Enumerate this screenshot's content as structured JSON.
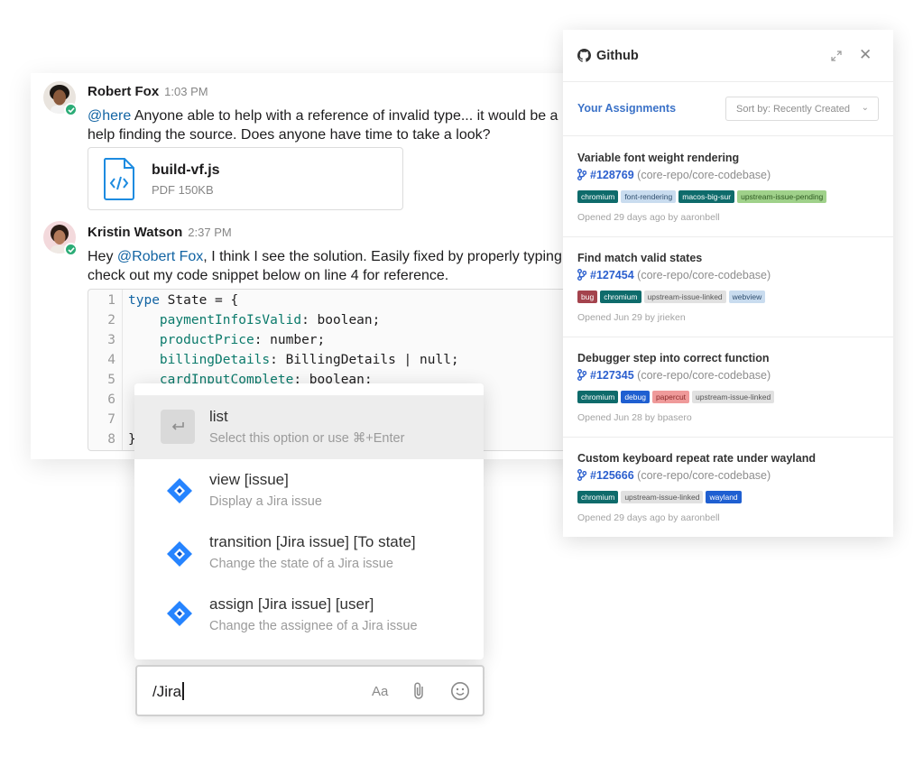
{
  "chat": {
    "messages": [
      {
        "author": "Robert Fox",
        "time": "1:03 PM",
        "mention": "@here",
        "text_1": " Anyone able to help with a reference of invalid type... it would be a",
        "text_2": "help finding the source. Does anyone have time to take a look?",
        "file": {
          "name": "build-vf.js",
          "meta": "PDF 150KB",
          "icon": "code-file-icon"
        }
      },
      {
        "author": "Kristin Watson",
        "time": "2:37 PM",
        "prefix": "Hey ",
        "mention": "@Robert Fox",
        "text_1": ", I think I see the solution. Easily fixed by properly typing",
        "text_2": "check out my code snippet below on line 4 for reference."
      }
    ],
    "code": {
      "lines": [
        {
          "n": "1",
          "kw": "type",
          "rest": " State = {"
        },
        {
          "n": "2",
          "prop": "    paymentInfoIsValid",
          "rest": ": boolean;"
        },
        {
          "n": "3",
          "prop": "    productPrice",
          "rest": ": number;"
        },
        {
          "n": "4",
          "prop": "    billingDetails",
          "rest": ": BillingDetails | null;"
        },
        {
          "n": "5",
          "prop": "    cardInputComplete",
          "rest": ": boolean;"
        },
        {
          "n": "6",
          "rest": ""
        },
        {
          "n": "7",
          "rest": ""
        },
        {
          "n": "8",
          "rest": "}"
        }
      ]
    }
  },
  "popup": {
    "options": [
      {
        "title": "list",
        "sub": "Select this option or use ⌘+Enter",
        "icon": "enter-icon",
        "selected": true
      },
      {
        "title": "view [issue]",
        "sub": "Display a Jira issue",
        "icon": "jira-icon"
      },
      {
        "title": "transition [Jira issue] [To state]",
        "sub": "Change the state of a Jira issue",
        "icon": "jira-icon"
      },
      {
        "title": "assign [Jira issue] [user]",
        "sub": "Change the assignee of a Jira issue",
        "icon": "jira-icon"
      }
    ]
  },
  "composer": {
    "value": "/Jira",
    "format_label": "Aa",
    "attach_icon": "paperclip-icon",
    "emoji_icon": "smiley-icon"
  },
  "github": {
    "title": "Github",
    "section": "Your Assignments",
    "sort": "Sort by: Recently Created",
    "issues": [
      {
        "title": "Variable font weight rendering",
        "number": "#128769",
        "repo": "(core-repo/core-codebase)",
        "labels": [
          {
            "text": "chromium",
            "bg": "#0e6b6b",
            "fg": "#ffffff"
          },
          {
            "text": "font-rendering",
            "bg": "#c9dcef",
            "fg": "#2f4e6e"
          },
          {
            "text": "macos-big-sur",
            "bg": "#0e6b6b",
            "fg": "#ffffff"
          },
          {
            "text": "upstream-issue-pending",
            "bg": "#9fd18a",
            "fg": "#2f5a22"
          }
        ],
        "opened": "Opened 29 days ago by aaronbell"
      },
      {
        "title": "Find match valid states",
        "number": "#127454",
        "repo": "(core-repo/core-codebase)",
        "labels": [
          {
            "text": "bug",
            "bg": "#a4434d",
            "fg": "#ffffff"
          },
          {
            "text": "chromium",
            "bg": "#0e6b6b",
            "fg": "#ffffff"
          },
          {
            "text": "upstream-issue-linked",
            "bg": "#e1e1e1",
            "fg": "#555555"
          },
          {
            "text": "webview",
            "bg": "#c9dcef",
            "fg": "#2f4e6e"
          }
        ],
        "opened": "Opened Jun 29 by jrieken"
      },
      {
        "title": "Debugger step into correct function",
        "number": "#127345",
        "repo": "(core-repo/core-codebase)",
        "labels": [
          {
            "text": "chromium",
            "bg": "#0e6b6b",
            "fg": "#ffffff"
          },
          {
            "text": "debug",
            "bg": "#1f5fd1",
            "fg": "#ffffff"
          },
          {
            "text": "papercut",
            "bg": "#ef9a9a",
            "fg": "#8a2a2a"
          },
          {
            "text": "upstream-issue-linked",
            "bg": "#e1e1e1",
            "fg": "#555555"
          }
        ],
        "opened": "Opened Jun 28 by bpasero"
      },
      {
        "title": "Custom keyboard repeat rate under wayland",
        "number": "#125666",
        "repo": "(core-repo/core-codebase)",
        "labels": [
          {
            "text": "chromium",
            "bg": "#0e6b6b",
            "fg": "#ffffff"
          },
          {
            "text": "upstream-issue-linked",
            "bg": "#e1e1e1",
            "fg": "#555555"
          },
          {
            "text": "wayland",
            "bg": "#1f5fd1",
            "fg": "#ffffff"
          }
        ],
        "opened": "Opened 29 days ago by aaronbell"
      }
    ]
  }
}
